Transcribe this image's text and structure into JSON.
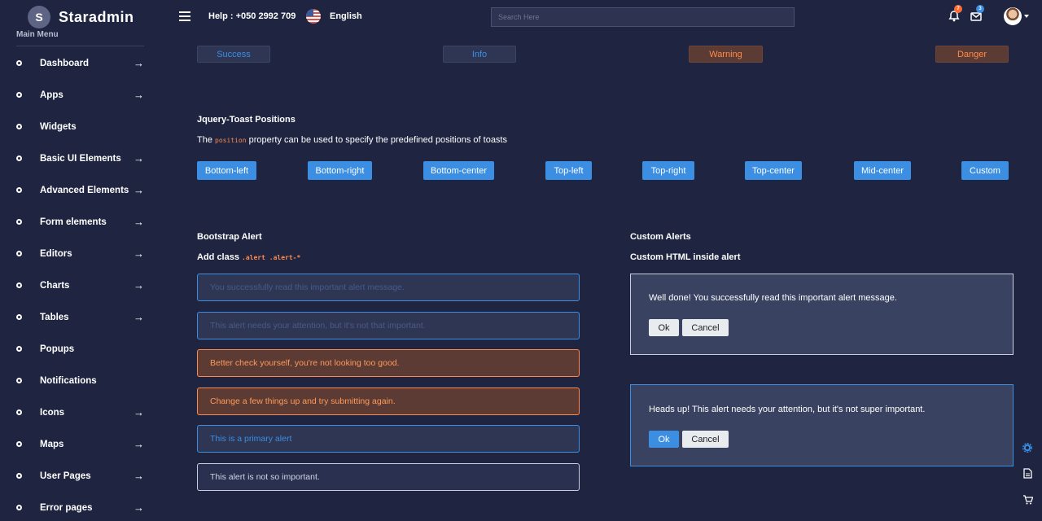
{
  "brand": {
    "logo_letter": "S",
    "name": "Staradmin"
  },
  "sidebar": {
    "caption": "Main Menu",
    "items": [
      {
        "label": "Dashboard",
        "has_arrow": true
      },
      {
        "label": "Apps",
        "has_arrow": true
      },
      {
        "label": "Widgets",
        "has_arrow": false
      },
      {
        "label": "Basic UI Elements",
        "has_arrow": true
      },
      {
        "label": "Advanced Elements",
        "has_arrow": true
      },
      {
        "label": "Form elements",
        "has_arrow": true
      },
      {
        "label": "Editors",
        "has_arrow": true
      },
      {
        "label": "Charts",
        "has_arrow": true
      },
      {
        "label": "Tables",
        "has_arrow": true
      },
      {
        "label": "Popups",
        "has_arrow": false
      },
      {
        "label": "Notifications",
        "has_arrow": false
      },
      {
        "label": "Icons",
        "has_arrow": true
      },
      {
        "label": "Maps",
        "has_arrow": true
      },
      {
        "label": "User Pages",
        "has_arrow": true
      },
      {
        "label": "Error pages",
        "has_arrow": true
      }
    ]
  },
  "navbar": {
    "help": "Help : +050 2992 709",
    "language": "English",
    "search_placeholder": "Search Here",
    "notifications_count": "7",
    "messages_count": "3"
  },
  "toast_types": {
    "success": "Success",
    "info": "Info",
    "warning": "Warning",
    "danger": "Danger"
  },
  "positions": {
    "title": "Jquery-Toast Positions",
    "desc_before": "The",
    "desc_code": "position",
    "desc_after": "property can be used to specify the predefined positions of toasts",
    "buttons": [
      "Bottom-left",
      "Bottom-right",
      "Bottom-center",
      "Top-left",
      "Top-right",
      "Top-center",
      "Mid-center",
      "Custom"
    ]
  },
  "bootstrap_alert": {
    "title": "Bootstrap Alert",
    "desc_before": "Add class",
    "desc_code": ".alert .alert-*",
    "alerts": [
      "You successfully read this important alert message.",
      "This alert needs your attention, but it's not that important.",
      "Better check yourself, you're not looking too good.",
      "Change a few things up and try submitting again.",
      "This is a primary alert",
      "This alert is not so important."
    ]
  },
  "custom_alerts": {
    "title": "Custom Alerts",
    "desc": "Custom HTML inside alert",
    "alert1": {
      "text": "Well done! You successfully read this important alert message.",
      "ok": "Ok",
      "cancel": "Cancel"
    },
    "alert2": {
      "text": "Heads up! This alert needs your attention, but it's not super important.",
      "ok": "Ok",
      "cancel": "Cancel"
    }
  },
  "colors": {
    "background": "#1f2541",
    "accent_blue": "#3b8ee2",
    "accent_orange": "#ff8a4c",
    "notification_badge": "#ff6b35",
    "message_badge": "#3b8ee2"
  },
  "icons": {
    "menu": "hamburger-icon",
    "bell": "bell-icon",
    "mail": "mail-icon",
    "settings": "gear-icon",
    "docs": "document-icon",
    "cart": "cart-icon"
  }
}
